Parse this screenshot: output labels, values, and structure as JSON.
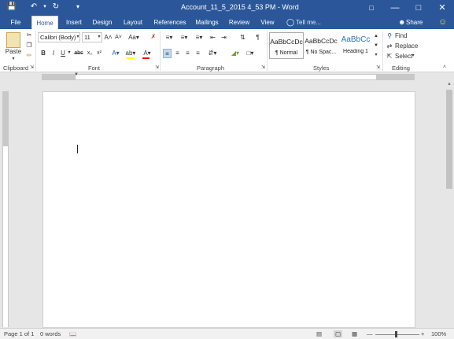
{
  "window": {
    "title": "Account_11_5_2015 4_53 PM - Word",
    "qat": {
      "save": "save-icon",
      "undo": "undo-icon",
      "redo": "redo-icon",
      "customize": "customize-qat-icon"
    },
    "controls": {
      "ribbon_display": "ribbon-display-icon",
      "minimize": "minimize-icon",
      "restore": "restore-icon",
      "close": "close-icon"
    }
  },
  "tabs": [
    {
      "label": "File"
    },
    {
      "label": "Home"
    },
    {
      "label": "Insert"
    },
    {
      "label": "Design"
    },
    {
      "label": "Layout"
    },
    {
      "label": "References"
    },
    {
      "label": "Mailings"
    },
    {
      "label": "Review"
    },
    {
      "label": "View"
    }
  ],
  "tell_me": "Tell me...",
  "share": "Share",
  "ribbon": {
    "clipboard": {
      "paste": "Paste",
      "label": "Clipboard"
    },
    "font": {
      "name": "Calibri (Body)",
      "size": "11",
      "label": "Font"
    },
    "paragraph": {
      "label": "Paragraph"
    },
    "styles": {
      "label": "Styles",
      "items": [
        {
          "preview": "AaBbCcDc",
          "name": "¶ Normal"
        },
        {
          "preview": "AaBbCcDc",
          "name": "¶ No Spac..."
        },
        {
          "preview": "AaBbCc",
          "name": "Heading 1"
        }
      ]
    },
    "editing": {
      "find": "Find",
      "replace": "Replace",
      "select": "Select",
      "label": "Editing"
    }
  },
  "status": {
    "page": "Page 1 of 1",
    "words": "0 words",
    "zoom": "100%"
  },
  "colors": {
    "brand": "#2b579a",
    "highlight_bar": "#ffff00",
    "font_color_bar": "#ff0000"
  }
}
